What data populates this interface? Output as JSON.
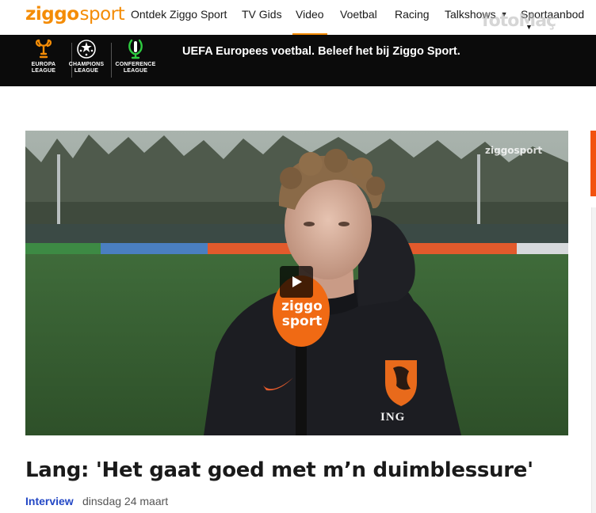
{
  "header": {
    "logo_main": "ziggo",
    "logo_sport": "sport",
    "nav": [
      {
        "label": "Ontdek Ziggo Sport",
        "active": false
      },
      {
        "label": "TV Gids",
        "active": false
      },
      {
        "label": "Video",
        "active": true
      },
      {
        "label": "Voetbal",
        "active": false
      },
      {
        "label": "Racing",
        "active": false
      },
      {
        "label": "Talkshows",
        "active": false,
        "dropdown": true
      },
      {
        "label": "Sportaanbod",
        "active": false,
        "dropdown": true
      }
    ],
    "watermark": "fotoMaç"
  },
  "banner": {
    "competitions": [
      {
        "line1": "EUROPA",
        "line2": "LEAGUE",
        "icon": "europa-league-trophy-icon"
      },
      {
        "line1": "CHAMPIONS",
        "line2": "LEAGUE",
        "icon": "champions-league-starball-icon"
      },
      {
        "line1": "CONFERENCE",
        "line2": "LEAGUE",
        "icon": "conference-league-trophy-icon"
      }
    ],
    "text": "UEFA Europees voetbal. Beleef het bij Ziggo Sport."
  },
  "video": {
    "channel_watermark": "ziggosport",
    "mic_line1": "ziggo",
    "mic_line2": "sport",
    "jacket_sponsor": "ING",
    "play_icon": "play-icon"
  },
  "article": {
    "title": "Lang: 'Het gaat goed met m’n duimblessure'",
    "category": "Interview",
    "date": "dinsdag 24 maart"
  },
  "colors": {
    "brand_orange": "#f48c06",
    "link_blue": "#2448c5",
    "banner_bg": "#0b0b0b",
    "side_accent": "#f2520f"
  }
}
